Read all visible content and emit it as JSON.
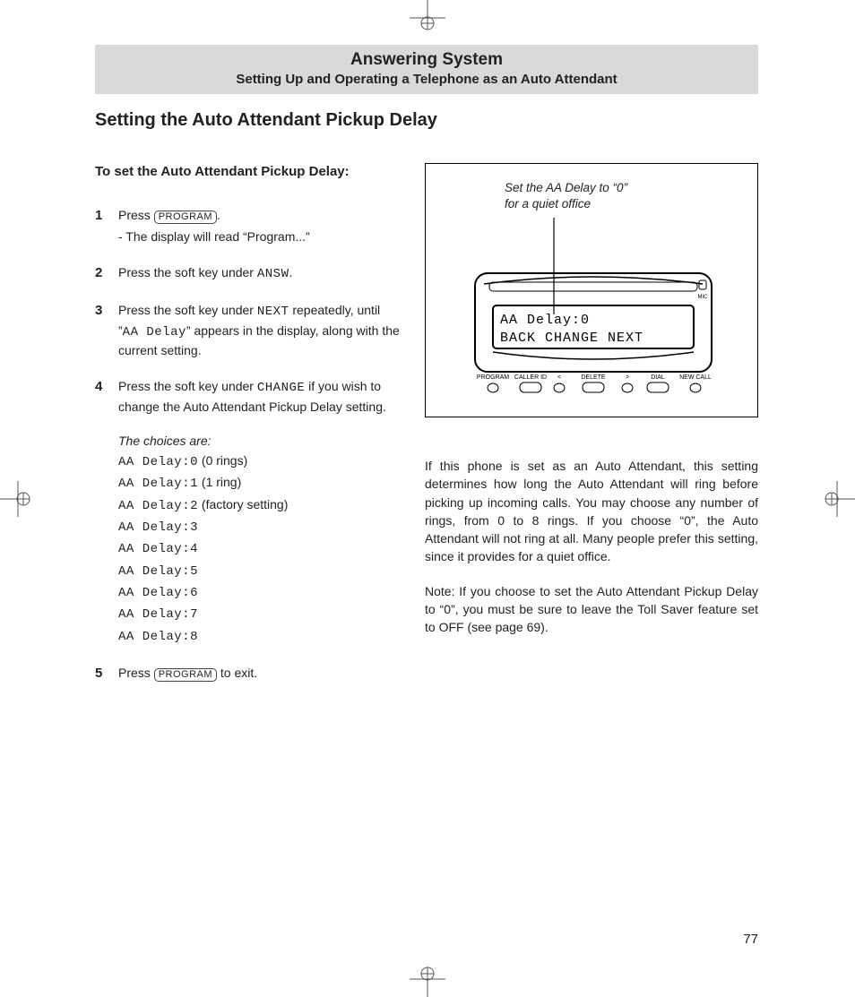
{
  "header": {
    "line1": "Answering System",
    "line2": "Setting Up and Operating a Telephone as an Auto Attendant"
  },
  "section_title": "Setting the Auto Attendant Pickup Delay",
  "intro": "To set the Auto Attendant Pickup Delay:",
  "steps": [
    {
      "num": "1",
      "pre": "Press ",
      "button": "PROGRAM",
      "post": ".",
      "sub": "- The display will read “Program...”"
    },
    {
      "num": "2",
      "pre": "Press the soft key under ",
      "lcd": "ANSW",
      "post": "."
    },
    {
      "num": "3",
      "pre": "Press the soft key under ",
      "lcd": "NEXT",
      "post": " repeatedly, until ”",
      "lcd2": "AA Delay",
      "post2": "” appears in the display, along with the current setting."
    },
    {
      "num": "4",
      "pre": "Press the soft key under ",
      "lcd": "CHANGE",
      "post": " if you wish to change the Auto Attendant Pickup Delay setting.",
      "choices_intro": "The choices are:",
      "choices": [
        {
          "code": "AA Delay:0",
          "note": " (0 rings)"
        },
        {
          "code": "AA Delay:1",
          "note": " (1 ring)"
        },
        {
          "code": "AA Delay:2",
          "note": " (factory setting)"
        },
        {
          "code": "AA Delay:3",
          "note": ""
        },
        {
          "code": "AA Delay:4",
          "note": ""
        },
        {
          "code": "AA Delay:5",
          "note": ""
        },
        {
          "code": "AA Delay:6",
          "note": ""
        },
        {
          "code": "AA Delay:7",
          "note": ""
        },
        {
          "code": "AA Delay:8",
          "note": ""
        }
      ]
    },
    {
      "num": "5",
      "pre": "Press ",
      "button": "PROGRAM",
      "post": "  to exit."
    }
  ],
  "illustration": {
    "caption_line1": "Set the AA Delay to “0”",
    "caption_line2": "for a quiet office",
    "display_line1": "AA Delay:0",
    "display_line2": "BACK CHANGE NEXT",
    "labels": {
      "program": "PROGRAM",
      "callerid": "CALLER ID",
      "delete": "DELETE",
      "dial": "DIAL",
      "newcall": "NEW CALL",
      "mic": "MIC",
      "lt": "<",
      "gt": ">"
    }
  },
  "body": [
    "If this phone is set as an Auto Attendant, this setting determines how long the Auto Attendant will ring before picking up incoming calls. You may choose any number of rings, from 0 to 8 rings.  If you choose “0”, the Auto Attendant will not ring at all. Many people prefer this setting, since it provides for a quiet office.",
    "Note: If you choose to set the Auto Attendant Pickup Delay to “0”, you must be sure to leave the Toll Saver feature set to OFF (see page 69)."
  ],
  "page_number": "77"
}
